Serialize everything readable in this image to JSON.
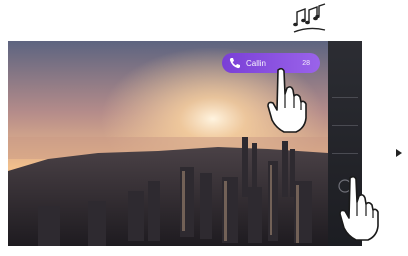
{
  "call_badge": {
    "label": "Callin",
    "time": "28"
  },
  "icons": [
    "music-notes-icon",
    "phone-icon",
    "hand-pointer-icon",
    "arrow-right-icon",
    "sidebar-button-icon"
  ],
  "colors": {
    "badge": "#8a4fe0",
    "sidebar": "#26272d",
    "sky_top": "#6a6f88",
    "sky_glow": "#f3b47d"
  }
}
